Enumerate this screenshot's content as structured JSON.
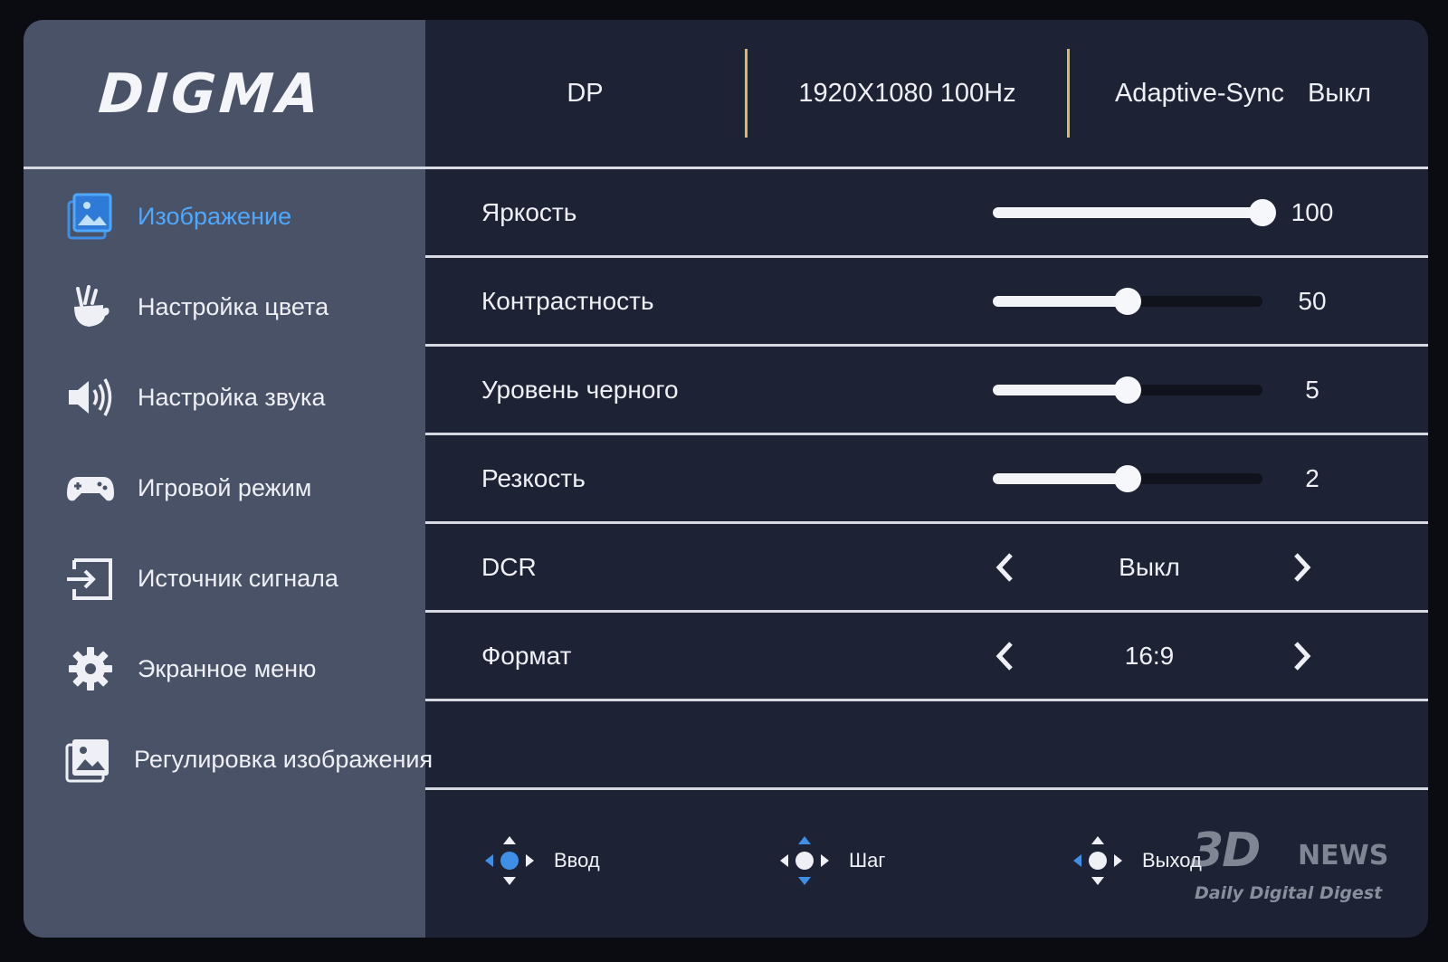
{
  "brand": {
    "logo_text": "DIGMA"
  },
  "header": {
    "input": "DP",
    "resolution": "1920X1080 100Hz",
    "adaptive_sync_label": "Adaptive-Sync",
    "adaptive_sync_value": "Выкл"
  },
  "sidebar": {
    "items": [
      {
        "label": "Изображение",
        "icon": "image-icon",
        "active": true
      },
      {
        "label": "Настройка цвета",
        "icon": "color-palette-icon",
        "active": false
      },
      {
        "label": "Настройка звука",
        "icon": "speaker-icon",
        "active": false
      },
      {
        "label": "Игровой режим",
        "icon": "gamepad-icon",
        "active": false
      },
      {
        "label": "Источник сигнала",
        "icon": "input-source-icon",
        "active": false
      },
      {
        "label": "Экранное меню",
        "icon": "gear-icon",
        "active": false
      },
      {
        "label": "Регулировка изображения",
        "icon": "image-adjust-icon",
        "active": false
      }
    ]
  },
  "settings": {
    "brightness": {
      "label": "Яркость",
      "value": "100",
      "level": 1.0
    },
    "contrast": {
      "label": "Контрастность",
      "value": "50",
      "level": 0.5
    },
    "black_level": {
      "label": "Уровень черного",
      "value": "5",
      "level": 0.5
    },
    "sharpness": {
      "label": "Резкость",
      "value": "2",
      "level": 0.5
    },
    "dcr": {
      "label": "DCR",
      "value": "Выкл"
    },
    "aspect": {
      "label": "Формат",
      "value": "16:9"
    }
  },
  "footer": {
    "enter_label": "Ввод",
    "step_label": "Шаг",
    "exit_label": "Выход"
  },
  "watermark": {
    "main": "3D",
    "news": "NEWS",
    "tagline": "Daily Digital Digest"
  },
  "colors": {
    "accent": "#4ea8ff",
    "separator": "#d9b96a",
    "panel": "#1d2234",
    "sidebar": "#4a5267"
  }
}
